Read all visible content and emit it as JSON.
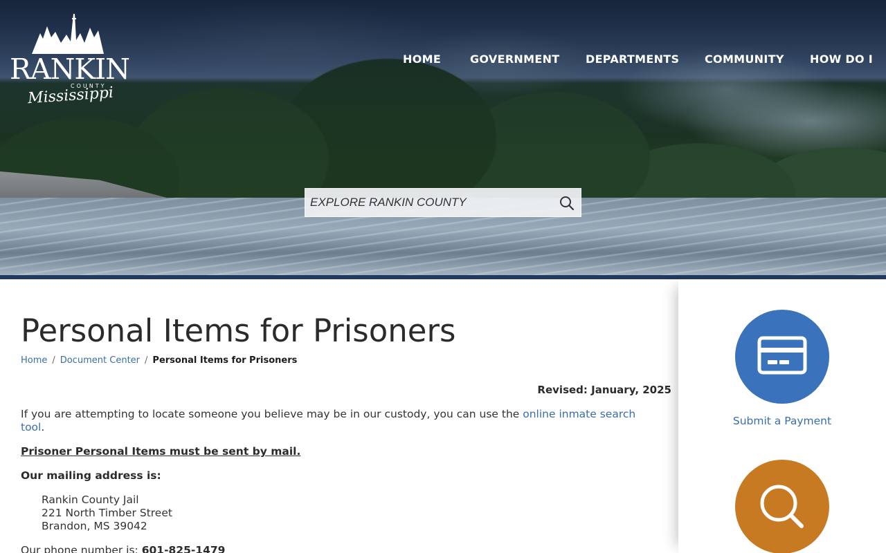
{
  "site": {
    "logo_word": "RANKIN",
    "logo_county": "COUNTY",
    "logo_state": "Mississippi"
  },
  "nav": {
    "items": [
      "HOME",
      "GOVERNMENT",
      "DEPARTMENTS",
      "COMMUNITY",
      "HOW DO I"
    ]
  },
  "search": {
    "placeholder": "EXPLORE RANKIN COUNTY",
    "icon": "search-icon"
  },
  "page": {
    "title": "Personal Items for Prisoners",
    "breadcrumbs": [
      "Home",
      "Document Center",
      "Personal Items for Prisoners"
    ],
    "breadcrumb_separator": "/",
    "revised": "Revised: January, 2025",
    "intro_text": "If you are attempting to locate someone you believe may be in our custody, you can use the ",
    "intro_link": "online inmate search tool",
    "intro_end": ".",
    "must_mail": "Prisoner Personal Items must be sent by mail.",
    "mailing_heading": "Our mailing address is:",
    "address": [
      "Rankin County Jail",
      "221 North Timber Street",
      "Brandon, MS 39042"
    ],
    "phone_label": "Our phone number is: ",
    "phone_value": "601-825-1479"
  },
  "sidebar": {
    "payment_label": "Submit a Payment",
    "payment_icon": "credit-card-icon",
    "payment_color": "#3a72bb",
    "search_icon": "magnifier-icon",
    "search_color": "#c87a22"
  }
}
